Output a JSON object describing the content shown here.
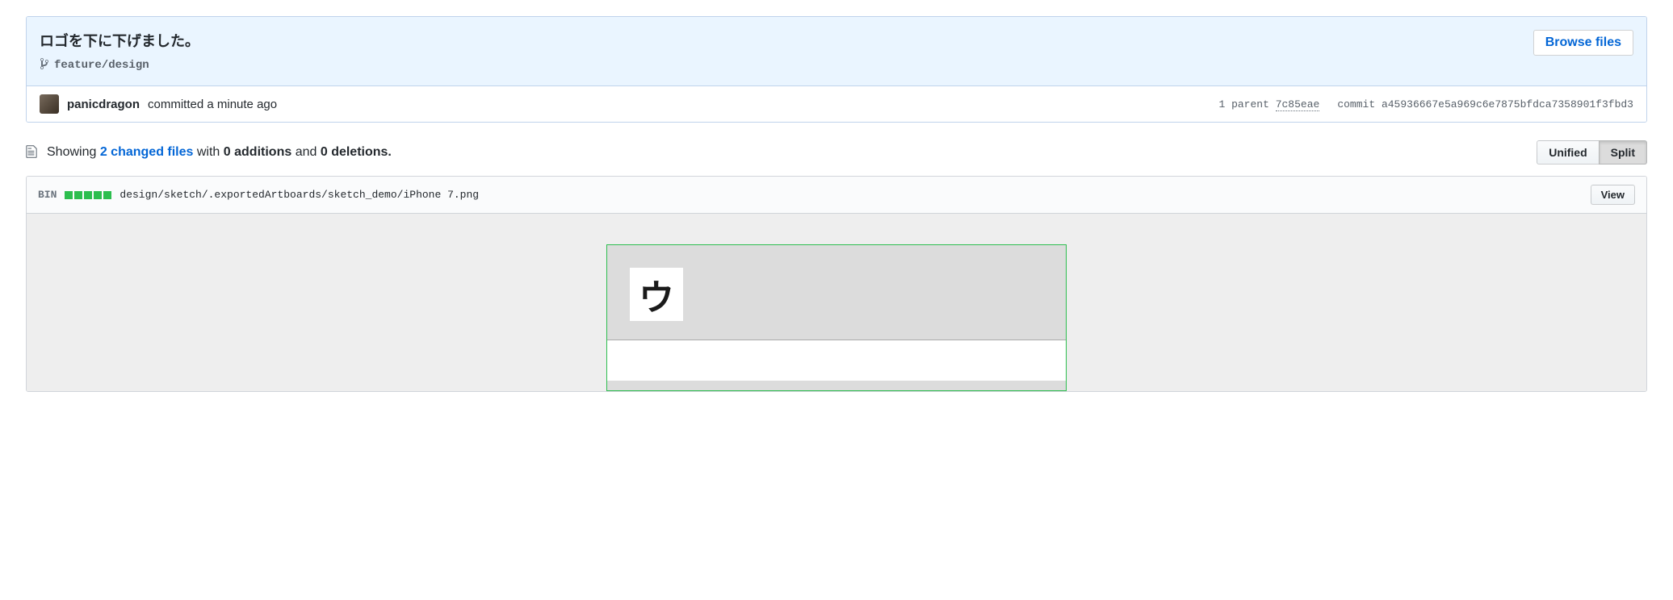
{
  "commit": {
    "title": "ロゴを下に下げました。",
    "branch": "feature/design",
    "browse_button": "Browse files",
    "author": "panicdragon",
    "action_text": "committed a minute ago",
    "parent_label": "1 parent",
    "parent_sha": "7c85eae",
    "commit_label": "commit",
    "commit_sha": "a45936667e5a969c6e7875bfdca7358901f3fbd3"
  },
  "diffstat": {
    "showing": "Showing",
    "changed_files": "2 changed files",
    "with": "with",
    "additions": "0 additions",
    "and": "and",
    "deletions": "0 deletions."
  },
  "diff_view": {
    "unified": "Unified",
    "split": "Split"
  },
  "file": {
    "bin_label": "BIN",
    "path": "design/sketch/.exportedArtboards/sketch_demo/iPhone 7.png",
    "view_button": "View",
    "preview_glyph": "ウ"
  }
}
